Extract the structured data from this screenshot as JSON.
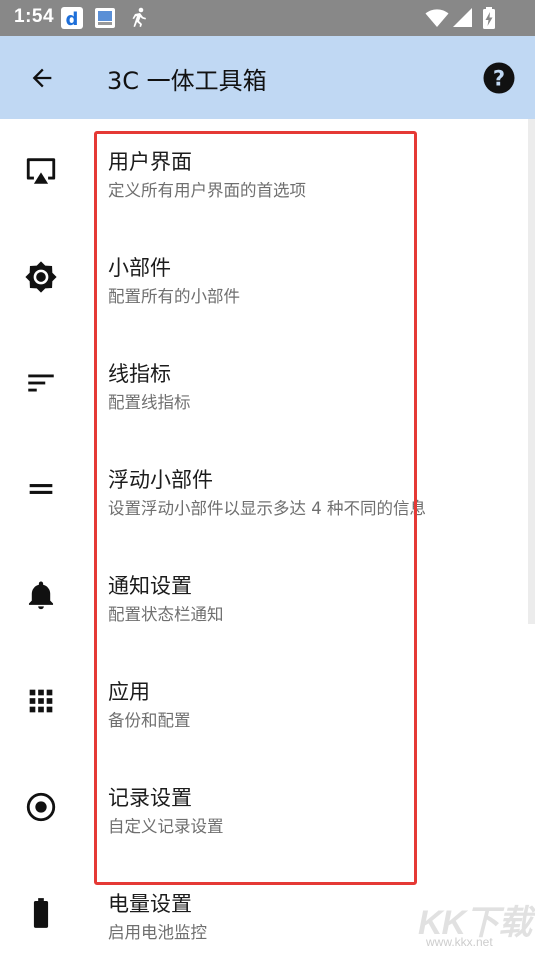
{
  "status_bar": {
    "time": "1:54",
    "icons": [
      "d-app-icon",
      "photo-app-icon",
      "running-icon",
      "wifi-icon",
      "signal-icon",
      "battery-charging-icon"
    ]
  },
  "app_bar": {
    "title": "3C 一体工具箱",
    "back_icon": "arrow-back-icon",
    "help_icon": "help-icon"
  },
  "items": [
    {
      "title": "用户界面",
      "subtitle": "定义所有用户界面的首选项",
      "icon": "cast-screen-icon"
    },
    {
      "title": "小部件",
      "subtitle": "配置所有的小部件",
      "icon": "brightness-gear-icon"
    },
    {
      "title": "线指标",
      "subtitle": "配置线指标",
      "icon": "sort-lines-icon"
    },
    {
      "title": "浮动小部件",
      "subtitle": "设置浮动小部件以显示多达 4 种不同的信息",
      "icon": "equals-icon"
    },
    {
      "title": "通知设置",
      "subtitle": "配置状态栏通知",
      "icon": "bell-icon"
    },
    {
      "title": "应用",
      "subtitle": "备份和配置",
      "icon": "apps-grid-icon"
    },
    {
      "title": "记录设置",
      "subtitle": "自定义记录设置",
      "icon": "record-circle-icon"
    },
    {
      "title": "电量设置",
      "subtitle": "启用电池监控",
      "icon": "battery-icon"
    }
  ],
  "watermark": {
    "text": "KK下载",
    "url": "www.kkx.net"
  },
  "colors": {
    "status_bar": "#888888",
    "app_bar": "#c0d8f3",
    "highlight": "#e53935"
  }
}
